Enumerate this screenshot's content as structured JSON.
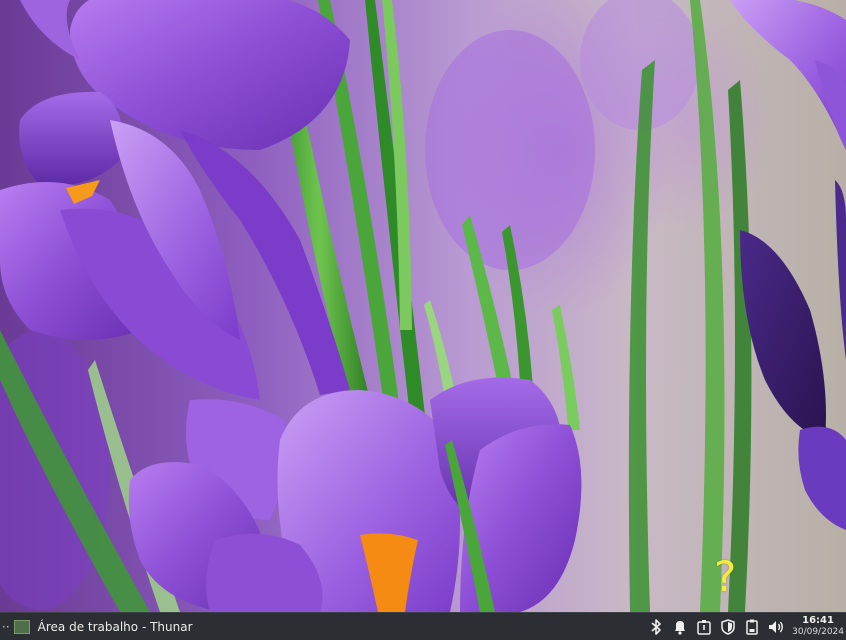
{
  "desktop": {
    "wallpaper_subject": "purple crocus flowers with green leaves",
    "help_glyph": "?"
  },
  "taskbar": {
    "background_color": "#2b2e33",
    "task": {
      "icon": "thunar-window-icon",
      "title": "Área de trabalho - Thunar"
    },
    "tray_icons": [
      "bluetooth-icon",
      "notification-bell-icon",
      "power-manager-icon",
      "shield-icon",
      "battery-clipboard-icon",
      "volume-icon"
    ],
    "clock": {
      "time": "16:41",
      "date": "30/09/2024"
    }
  }
}
